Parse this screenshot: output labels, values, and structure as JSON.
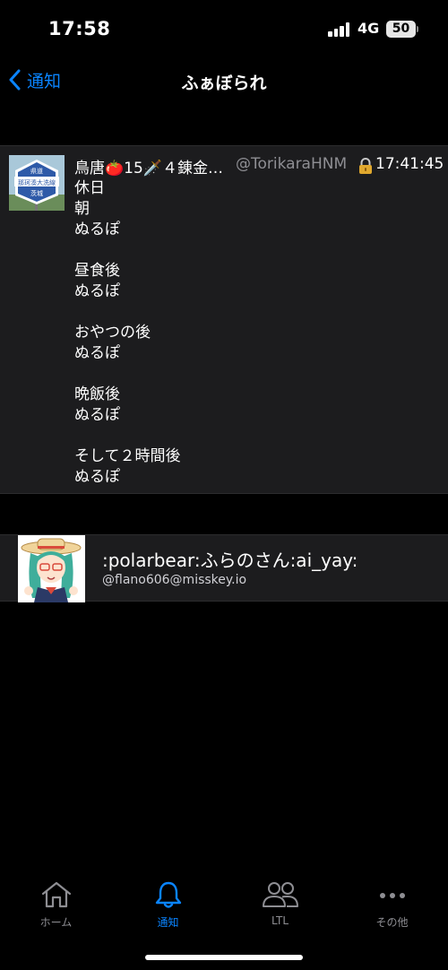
{
  "status_bar": {
    "time": "17:58",
    "network": "4G",
    "battery": "50"
  },
  "nav": {
    "back_label": "通知",
    "title": "ふぁぼられ"
  },
  "note": {
    "user_name": "鳥唐🍅15🗡️４錬金…",
    "user_handle": "@TorikaraHNM",
    "time": "17:41:45",
    "avatar_sign_top": "県道",
    "avatar_sign_middle": "那珂湊大洗線",
    "avatar_sign_bottom": "茨城",
    "text": "休日\n朝\nぬるぽ\n\n昼食後\nぬるぽ\n\nおやつの後\nぬるぽ\n\n晩飯後\nぬるぽ\n\nそして２時間後\nぬるぽ"
  },
  "reaction_user": {
    "name": ":polarbear:ふらのさん:ai_yay:",
    "handle": "@flano606@misskey.io"
  },
  "tabs": [
    {
      "label": "ホーム",
      "icon": "home-icon"
    },
    {
      "label": "通知",
      "icon": "bell-icon",
      "active": true
    },
    {
      "label": "LTL",
      "icon": "people-icon"
    },
    {
      "label": "その他",
      "icon": "more-icon"
    }
  ],
  "colors": {
    "accent": "#0a84ff",
    "card_bg": "#1c1c1e",
    "muted": "#8e8e93"
  }
}
